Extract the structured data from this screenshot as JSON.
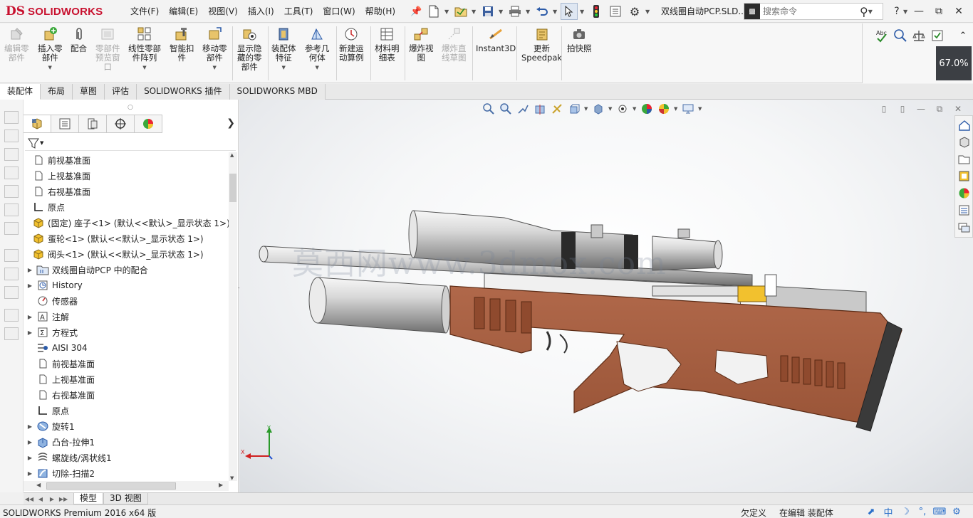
{
  "titlebar": {
    "logo_ds": "DS",
    "logo_text": "SOLIDWORKS",
    "menus": [
      "文件(F)",
      "编辑(E)",
      "视图(V)",
      "插入(I)",
      "工具(T)",
      "窗口(W)",
      "帮助(H)"
    ],
    "document_title": "双线圈自动PCP.SLD...",
    "search_placeholder": "搜索命令",
    "help_label": "?"
  },
  "ribbon": {
    "buttons": [
      {
        "label": "编辑零\n部件",
        "icon": "edit-component-icon",
        "disabled": true
      },
      {
        "label": "插入零\n部件",
        "icon": "insert-component-icon",
        "disabled": false
      },
      {
        "label": "配合",
        "icon": "mate-icon",
        "disabled": false
      },
      {
        "label": "零部件\n预览窗\n口",
        "icon": "component-preview-icon",
        "disabled": true
      },
      {
        "label": "线性零部\n件阵列",
        "icon": "linear-pattern-icon",
        "disabled": false
      },
      {
        "label": "智能扣\n件",
        "icon": "smart-fastener-icon",
        "disabled": false
      },
      {
        "label": "移动零\n部件",
        "icon": "move-component-icon",
        "disabled": false
      },
      {
        "label": "显示隐\n藏的零\n部件",
        "icon": "show-hidden-icon",
        "disabled": false
      },
      {
        "label": "装配体\n特征",
        "icon": "assembly-feature-icon",
        "disabled": false
      },
      {
        "label": "参考几\n何体",
        "icon": "reference-geometry-icon",
        "disabled": false
      },
      {
        "label": "新建运\n动算例",
        "icon": "motion-study-icon",
        "disabled": false
      },
      {
        "label": "材料明\n细表",
        "icon": "bom-icon",
        "disabled": false
      },
      {
        "label": "爆炸视\n图",
        "icon": "exploded-view-icon",
        "disabled": false
      },
      {
        "label": "爆炸直\n线草图",
        "icon": "explode-line-icon",
        "disabled": true
      },
      {
        "label": "Instant3D",
        "icon": "instant3d-icon",
        "disabled": false
      },
      {
        "label": "更新\nSpeedpak",
        "icon": "speedpak-icon",
        "disabled": false
      },
      {
        "label": "拍快照",
        "icon": "snapshot-icon",
        "disabled": false
      }
    ],
    "zoom_level": "67.0%"
  },
  "command_tabs": [
    "装配体",
    "布局",
    "草图",
    "评估",
    "SOLIDWORKS 插件",
    "SOLIDWORKS MBD"
  ],
  "feature_tree": {
    "nodes": [
      {
        "label": "前视基准面",
        "icon": "plane-icon",
        "expandable": false,
        "level": 0
      },
      {
        "label": "上视基准面",
        "icon": "plane-icon",
        "expandable": false,
        "level": 0
      },
      {
        "label": "右视基准面",
        "icon": "plane-icon",
        "expandable": false,
        "level": 0
      },
      {
        "label": "原点",
        "icon": "origin-icon",
        "expandable": false,
        "level": 0
      },
      {
        "label": "(固定) 座子<1> (默认<<默认>_显示状态 1>)",
        "icon": "part-icon",
        "expandable": false,
        "level": 0
      },
      {
        "label": "蛋轮<1> (默认<<默认>_显示状态 1>)",
        "icon": "part-icon",
        "expandable": false,
        "level": 0
      },
      {
        "label": "阀头<1> (默认<<默认>_显示状态 1>)",
        "icon": "part-icon",
        "expandable": false,
        "level": 0
      },
      {
        "label": "双线圈自动PCP 中的配合",
        "icon": "mates-folder-icon",
        "expandable": true,
        "level": 1
      },
      {
        "label": "History",
        "icon": "history-icon",
        "expandable": true,
        "level": 1
      },
      {
        "label": "传感器",
        "icon": "sensor-icon",
        "expandable": false,
        "level": 1
      },
      {
        "label": "注解",
        "icon": "annotation-icon",
        "expandable": true,
        "level": 1
      },
      {
        "label": "方程式",
        "icon": "equation-icon",
        "expandable": true,
        "level": 1
      },
      {
        "label": "AISI 304",
        "icon": "material-icon",
        "expandable": false,
        "level": 1
      },
      {
        "label": "前视基准面",
        "icon": "plane-icon",
        "expandable": false,
        "level": 1
      },
      {
        "label": "上视基准面",
        "icon": "plane-icon",
        "expandable": false,
        "level": 1
      },
      {
        "label": "右视基准面",
        "icon": "plane-icon",
        "expandable": false,
        "level": 1
      },
      {
        "label": "原点",
        "icon": "origin-icon",
        "expandable": false,
        "level": 1
      },
      {
        "label": "旋转1",
        "icon": "revolve-icon",
        "expandable": true,
        "level": 1
      },
      {
        "label": "凸台-拉伸1",
        "icon": "extrude-icon",
        "expandable": true,
        "level": 1
      },
      {
        "label": "螺旋线/涡状线1",
        "icon": "helix-icon",
        "expandable": true,
        "level": 1
      },
      {
        "label": "切除-扫描2",
        "icon": "cut-sweep-icon",
        "expandable": true,
        "level": 1
      }
    ]
  },
  "model_tabs": [
    "模型",
    "3D 视图"
  ],
  "viewport": {
    "watermark": "莫西网www.3dmox.com",
    "triad": {
      "x_label": "X",
      "y_label": "Y"
    }
  },
  "status": {
    "product": "SOLIDWORKS Premium 2016 x64 版",
    "definition": "欠定义",
    "mode": "在编辑 装配体"
  }
}
